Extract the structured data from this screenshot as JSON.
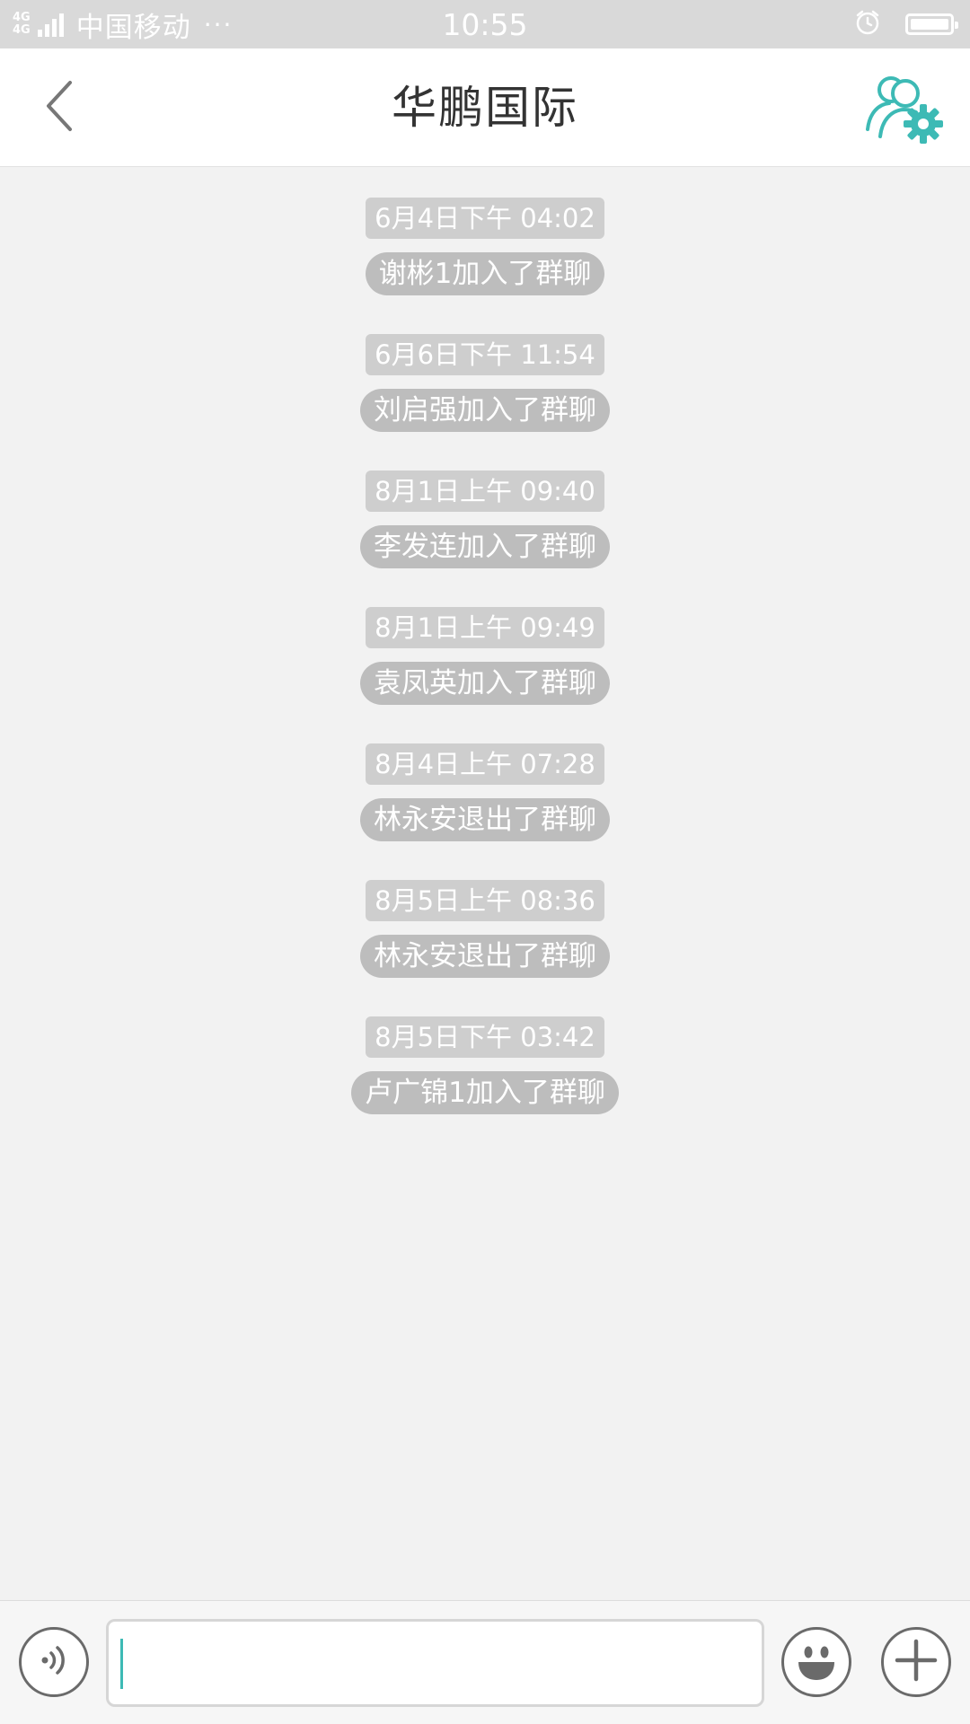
{
  "status_bar": {
    "network_label_top": "4G",
    "network_label_bottom": "4G",
    "carrier": "中国移动",
    "dots": "···",
    "time": "10:55"
  },
  "header": {
    "title": "华鹏国际"
  },
  "messages": [
    {
      "timestamp": "6月4日下午 04:02",
      "text": "谢彬1加入了群聊"
    },
    {
      "timestamp": "6月6日下午 11:54",
      "text": "刘启强加入了群聊"
    },
    {
      "timestamp": "8月1日上午 09:40",
      "text": "李发连加入了群聊"
    },
    {
      "timestamp": "8月1日上午 09:49",
      "text": "袁凤英加入了群聊"
    },
    {
      "timestamp": "8月4日上午 07:28",
      "text": "林永安退出了群聊"
    },
    {
      "timestamp": "8月5日上午 08:36",
      "text": "林永安退出了群聊"
    },
    {
      "timestamp": "8月5日下午 03:42",
      "text": "卢广锦1加入了群聊"
    }
  ],
  "input": {
    "value": "",
    "placeholder": ""
  },
  "icons": {
    "back": "chevron-left-icon",
    "group_settings": "group-settings-icon",
    "voice": "voice-icon",
    "emoji": "emoji-icon",
    "plus": "plus-icon",
    "alarm": "alarm-icon",
    "battery": "battery-icon"
  },
  "colors": {
    "accent": "#3dbab5",
    "timestamp_bg": "#cecece",
    "system_msg_bg": "#bdbdbd",
    "background": "#f2f2f2"
  }
}
